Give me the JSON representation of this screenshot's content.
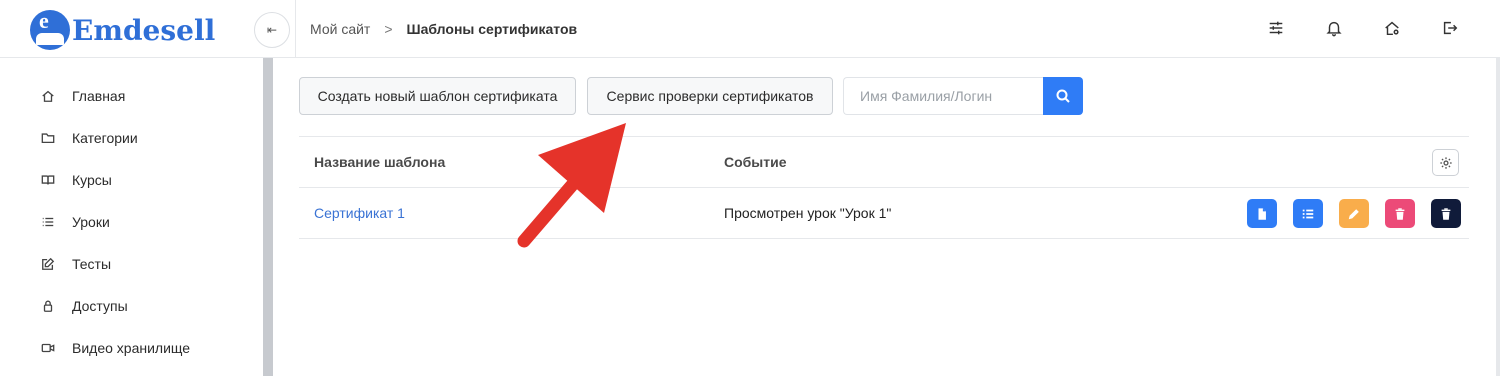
{
  "header": {
    "logo_text": "Emdesell",
    "logo_letter": "e",
    "collapse_glyph": "⇤",
    "breadcrumb": {
      "home": "Мой сайт",
      "separator": ">",
      "current": "Шаблоны сертификатов"
    },
    "icons": [
      "sliders-icon",
      "bell-icon",
      "home-settings-icon",
      "logout-icon"
    ]
  },
  "sidebar": {
    "items": [
      {
        "label": "Главная",
        "icon": "home-icon"
      },
      {
        "label": "Категории",
        "icon": "folder-icon"
      },
      {
        "label": "Курсы",
        "icon": "book-icon"
      },
      {
        "label": "Уроки",
        "icon": "list-icon"
      },
      {
        "label": "Тесты",
        "icon": "edit-icon"
      },
      {
        "label": "Доступы",
        "icon": "lock-icon"
      },
      {
        "label": "Видео хранилище",
        "icon": "video-icon"
      }
    ]
  },
  "toolbar": {
    "create_label": "Создать новый шаблон сертификата",
    "verify_label": "Сервис проверки сертификатов",
    "search_placeholder": "Имя Фамилия/Логин",
    "search_value": ""
  },
  "table": {
    "columns": [
      "Название шаблона",
      "Событие"
    ],
    "rows": [
      {
        "name": "Сертификат 1",
        "event": "Просмотрен урок \"Урок 1\""
      }
    ]
  },
  "colors": {
    "brand": "#2f6fd7",
    "primary": "#2f7cf6",
    "warning": "#f9ad4b",
    "danger": "#ec4a78",
    "dark": "#101b3a",
    "arrow": "#e5332a"
  }
}
